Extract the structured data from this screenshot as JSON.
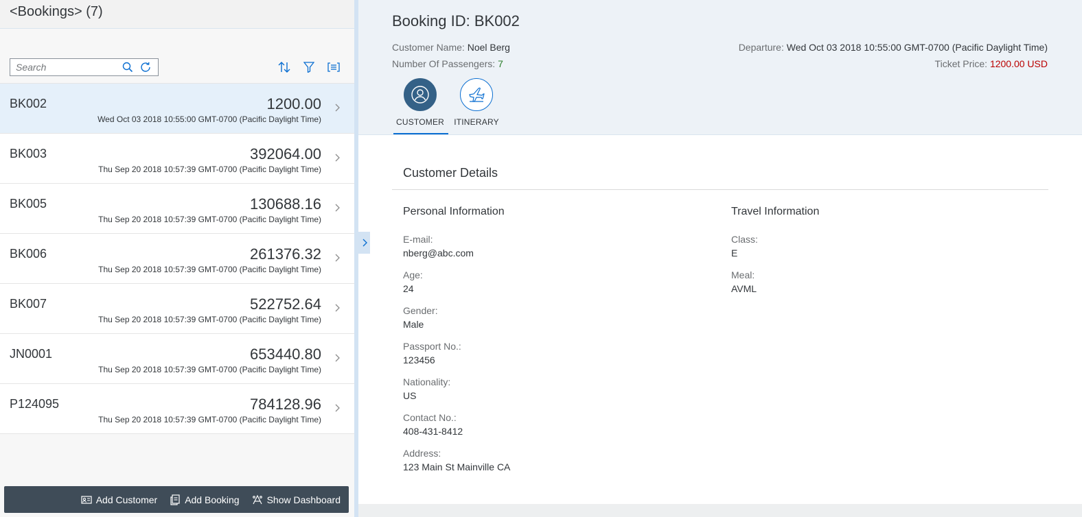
{
  "master": {
    "title": "<Bookings> (7)",
    "search_placeholder": "Search",
    "items": [
      {
        "id": "BK002",
        "amount": "1200.00",
        "date": "Wed Oct 03 2018 10:55:00 GMT-0700 (Pacific Daylight Time)",
        "selected": true
      },
      {
        "id": "BK003",
        "amount": "392064.00",
        "date": "Thu Sep 20 2018 10:57:39 GMT-0700 (Pacific Daylight Time)"
      },
      {
        "id": "BK005",
        "amount": "130688.16",
        "date": "Thu Sep 20 2018 10:57:39 GMT-0700 (Pacific Daylight Time)"
      },
      {
        "id": "BK006",
        "amount": "261376.32",
        "date": "Thu Sep 20 2018 10:57:39 GMT-0700 (Pacific Daylight Time)"
      },
      {
        "id": "BK007",
        "amount": "522752.64",
        "date": "Thu Sep 20 2018 10:57:39 GMT-0700 (Pacific Daylight Time)"
      },
      {
        "id": "JN0001",
        "amount": "653440.80",
        "date": "Thu Sep 20 2018 10:57:39 GMT-0700 (Pacific Daylight Time)"
      },
      {
        "id": "P124095",
        "amount": "784128.96",
        "date": "Thu Sep 20 2018 10:57:39 GMT-0700 (Pacific Daylight Time)"
      }
    ],
    "footer": {
      "add_customer": "Add Customer",
      "add_booking": "Add Booking",
      "show_dashboard": "Show Dashboard"
    }
  },
  "detail": {
    "title": "Booking ID: BK002",
    "customer_name_label": "Customer Name:",
    "customer_name": "Noel Berg",
    "passengers_label": "Number Of Passengers:",
    "passengers": "7",
    "departure_label": "Departure:",
    "departure": "Wed Oct 03 2018 10:55:00 GMT-0700 (Pacific Daylight Time)",
    "price_label": "Ticket Price:",
    "price": "1200.00 USD",
    "tabs": {
      "customer": "CUSTOMER",
      "itinerary": "ITINERARY"
    },
    "section_title": "Customer Details",
    "personal": {
      "title": "Personal Information",
      "email_label": "E-mail:",
      "email": "nberg@abc.com",
      "age_label": "Age:",
      "age": "24",
      "gender_label": "Gender:",
      "gender": "Male",
      "passport_label": "Passport No.:",
      "passport": "123456",
      "nationality_label": "Nationality:",
      "nationality": "US",
      "contact_label": "Contact No.:",
      "contact": "408-431-8412",
      "address_label": "Address:",
      "address": "123 Main St Mainville CA"
    },
    "travel": {
      "title": "Travel Information",
      "class_label": "Class:",
      "class": "E",
      "meal_label": "Meal:",
      "meal": "AVML"
    }
  },
  "colors": {
    "accent": "#0a6ed1",
    "positive": "#2b7d2b",
    "negative": "#bb0000",
    "shell": "#3f4c58"
  }
}
